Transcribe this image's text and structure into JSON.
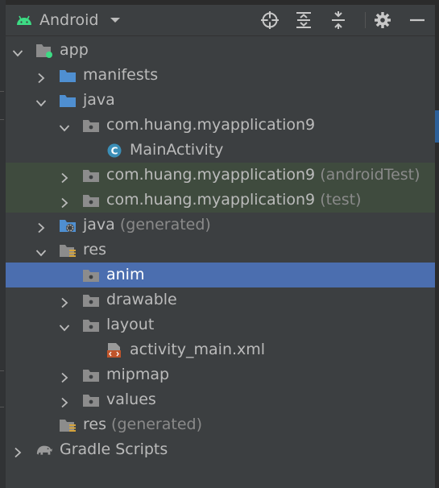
{
  "toolbar": {
    "view_title": "Android",
    "icons": [
      "android-icon",
      "locate-icon",
      "expand-all-icon",
      "collapse-all-icon",
      "gear-icon",
      "minimize-icon"
    ]
  },
  "colors": {
    "background": "#3c3f41",
    "text": "#bbbbbb",
    "secondary_text": "#8a8a8a",
    "selection": "#4b6eaf",
    "test_highlight": "#3f4b3e",
    "folder_blue": "#4f8fd1",
    "android_green": "#3ddc84"
  },
  "tree": [
    {
      "label": "app",
      "suffix": "",
      "level": 0,
      "state": "expanded",
      "icon": "module-folder-icon"
    },
    {
      "label": "manifests",
      "suffix": "",
      "level": 1,
      "state": "collapsed",
      "icon": "folder-icon"
    },
    {
      "label": "java",
      "suffix": "",
      "level": 1,
      "state": "expanded",
      "icon": "folder-icon"
    },
    {
      "label": "com.huang.myapplication9",
      "suffix": "",
      "level": 2,
      "state": "expanded",
      "icon": "package-icon"
    },
    {
      "label": "MainActivity",
      "suffix": "",
      "level": 3,
      "state": "leaf",
      "icon": "class-icon"
    },
    {
      "label": "com.huang.myapplication9",
      "suffix": "(androidTest)",
      "level": 2,
      "state": "collapsed",
      "icon": "package-icon",
      "highlight": "test"
    },
    {
      "label": "com.huang.myapplication9",
      "suffix": "(test)",
      "level": 2,
      "state": "collapsed",
      "icon": "package-icon",
      "highlight": "test"
    },
    {
      "label": "java",
      "suffix": "(generated)",
      "level": 1,
      "state": "collapsed",
      "icon": "generated-folder-icon"
    },
    {
      "label": "res",
      "suffix": "",
      "level": 1,
      "state": "expanded",
      "icon": "resource-folder-icon"
    },
    {
      "label": "anim",
      "suffix": "",
      "level": 2,
      "state": "leaf",
      "icon": "package-icon",
      "selected": true
    },
    {
      "label": "drawable",
      "suffix": "",
      "level": 2,
      "state": "collapsed",
      "icon": "package-icon"
    },
    {
      "label": "layout",
      "suffix": "",
      "level": 2,
      "state": "expanded",
      "icon": "package-icon"
    },
    {
      "label": "activity_main.xml",
      "suffix": "",
      "level": 3,
      "state": "leaf",
      "icon": "xml-layout-icon"
    },
    {
      "label": "mipmap",
      "suffix": "",
      "level": 2,
      "state": "collapsed",
      "icon": "package-icon"
    },
    {
      "label": "values",
      "suffix": "",
      "level": 2,
      "state": "collapsed",
      "icon": "package-icon"
    },
    {
      "label": "res",
      "suffix": "(generated)",
      "level": 1,
      "state": "leaf",
      "icon": "resource-folder-icon"
    },
    {
      "label": "Gradle Scripts",
      "suffix": "",
      "level": 0,
      "state": "collapsed",
      "icon": "gradle-elephant-icon"
    }
  ]
}
